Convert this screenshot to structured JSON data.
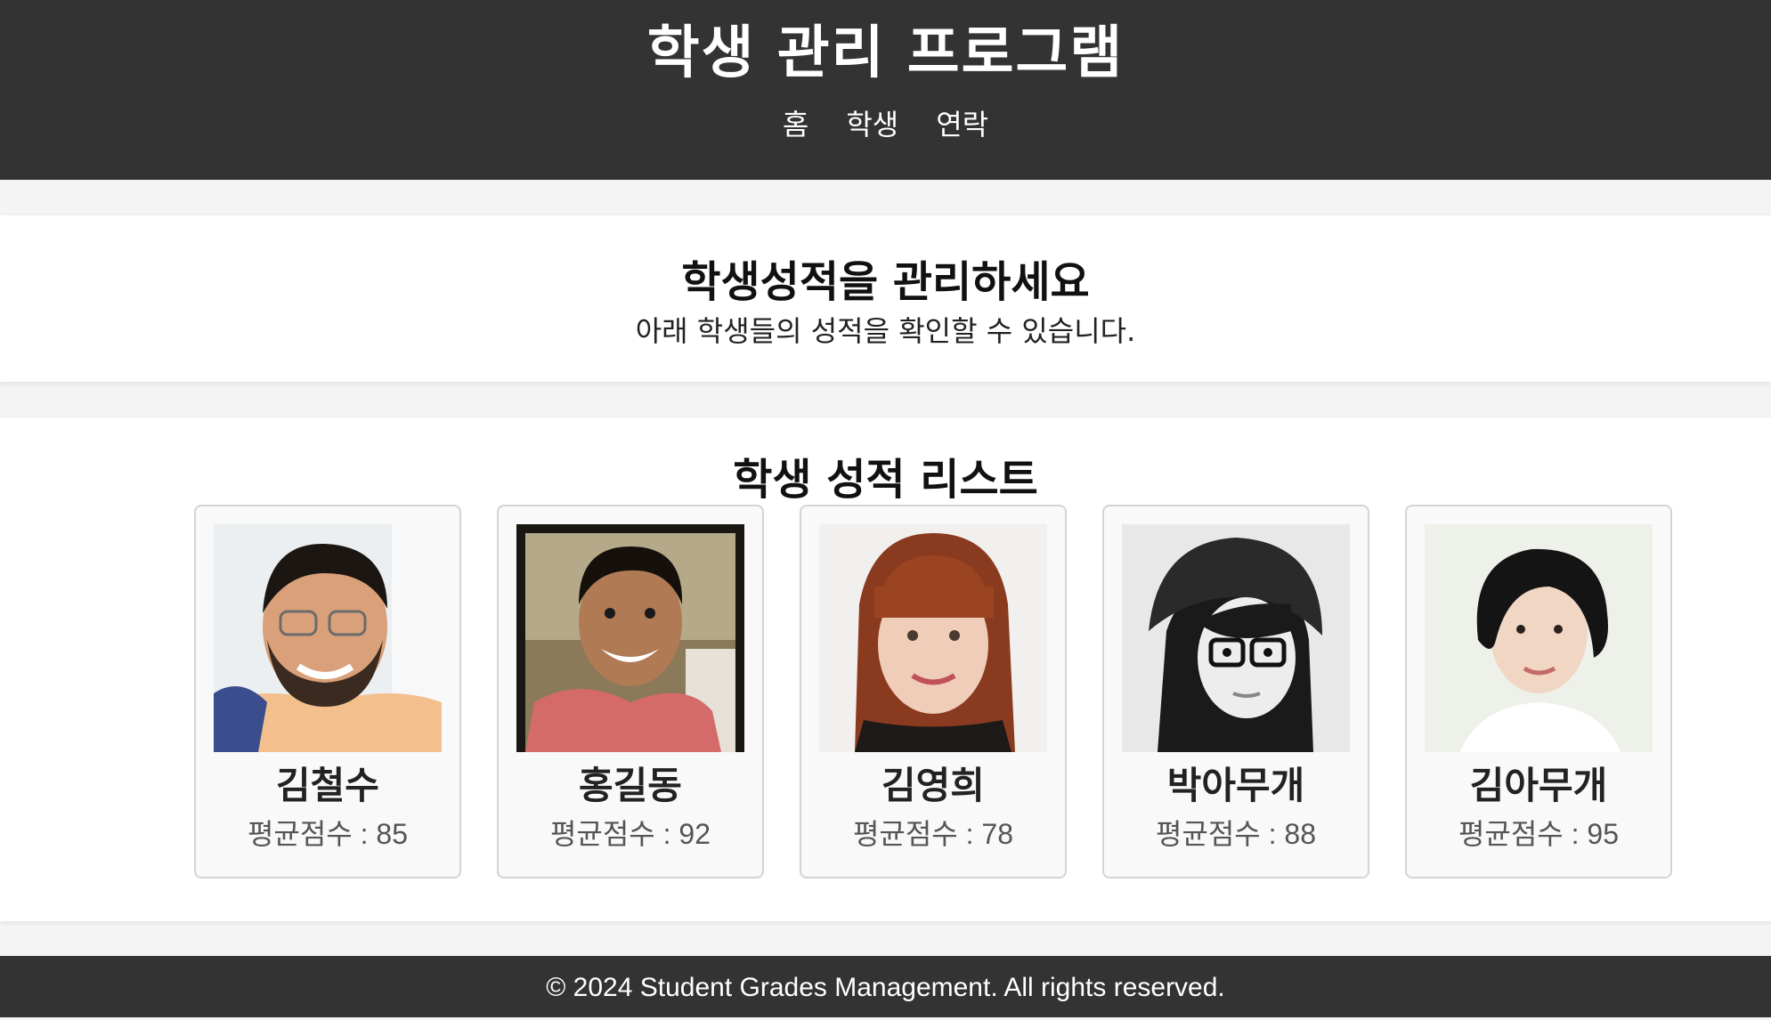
{
  "header": {
    "title": "학생 관리 프로그램",
    "nav": [
      "홈",
      "학생",
      "연락"
    ]
  },
  "hero": {
    "title": "학생성적을 관리하세요",
    "subtitle": "아래 학생들의 성적을 확인할 수 있습니다."
  },
  "list": {
    "title": "학생 성적 리스트",
    "students": [
      {
        "name": "김철수",
        "score_label": "평균점수 : 85",
        "photo_icon": "student-photo-male-glasses"
      },
      {
        "name": "홍길동",
        "score_label": "평균점수 : 92",
        "photo_icon": "student-photo-male-smiling"
      },
      {
        "name": "김영희",
        "score_label": "평균점수 : 78",
        "photo_icon": "student-photo-female-redhair"
      },
      {
        "name": "박아무개",
        "score_label": "평균점수 : 88",
        "photo_icon": "student-photo-female-beanie"
      },
      {
        "name": "김아무개",
        "score_label": "평균점수 : 95",
        "photo_icon": "student-photo-female-shorthair"
      }
    ]
  },
  "footer": {
    "text": "© 2024 Student Grades Management. All rights reserved."
  },
  "colors": {
    "header_bg": "#333333",
    "page_bg": "#f4f4f4",
    "card_bg": "#f9f9f9",
    "card_border": "#d4d4d4"
  }
}
